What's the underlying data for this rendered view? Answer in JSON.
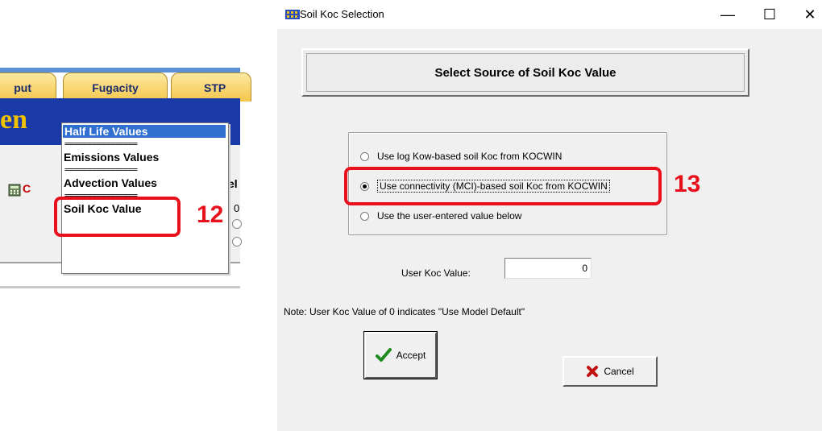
{
  "background_app": {
    "tabs": [
      {
        "label": "put"
      },
      {
        "label": "Fugacity"
      },
      {
        "label": "STP"
      }
    ],
    "title_fragment": "en",
    "calc_fragment": "C",
    "field_label_fragment": "el",
    "value_fragment": "0",
    "dropdown": {
      "items": [
        {
          "label": "Half Life Values"
        },
        {
          "label": "================"
        },
        {
          "label": "Emissions Values"
        },
        {
          "label": "================"
        },
        {
          "label": "Advection Values"
        },
        {
          "label": "================"
        },
        {
          "label": "Soil Koc Value"
        }
      ]
    },
    "callout_number": "12"
  },
  "dialog": {
    "title": "Soil Koc Selection",
    "controls": {
      "minimize": "—",
      "maximize": "☐",
      "close": "✕"
    },
    "header": "Select Source of Soil Koc Value",
    "options": [
      {
        "label": "Use log Kow-based soil Koc from KOCWIN",
        "selected": false
      },
      {
        "label": "Use connectivity (MCI)-based soil Koc from KOCWIN",
        "selected": true
      },
      {
        "label": "Use the user-entered value below",
        "selected": false
      }
    ],
    "user_koc_label": "User Koc Value:",
    "user_koc_value": "0",
    "note": "Note: User Koc Value of 0 indicates \"Use Model Default\"",
    "accept_label": "Accept",
    "cancel_label": "Cancel",
    "callout_number": "13"
  },
  "colors": {
    "highlight": "#e8101a",
    "tab_text": "#1b2b6b",
    "title_band": "#1a3aa8"
  }
}
